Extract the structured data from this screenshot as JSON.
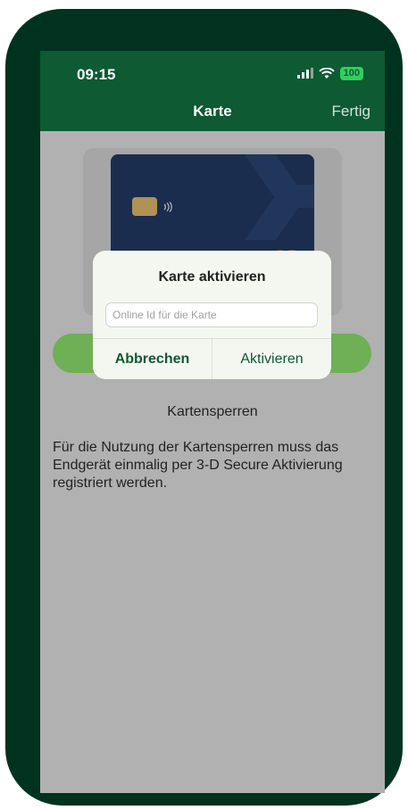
{
  "status_bar": {
    "time": "09:15",
    "battery": "100"
  },
  "nav": {
    "title": "Karte",
    "done_label": "Fertig"
  },
  "dialog": {
    "title": "Karte aktivieren",
    "input_placeholder": "Online Id für die Karte",
    "input_value": "",
    "cancel_label": "Abbrechen",
    "confirm_label": "Aktivieren"
  },
  "section": {
    "title": "Kartensperren",
    "info": "Für die Nutzung der Kartensperren muss das Endgerät einmalig per 3-D Secure Aktivierung registriert werden."
  },
  "colors": {
    "brand_green": "#0d5a33",
    "action_green": "#7bc95b",
    "card_navy": "#132a52"
  }
}
